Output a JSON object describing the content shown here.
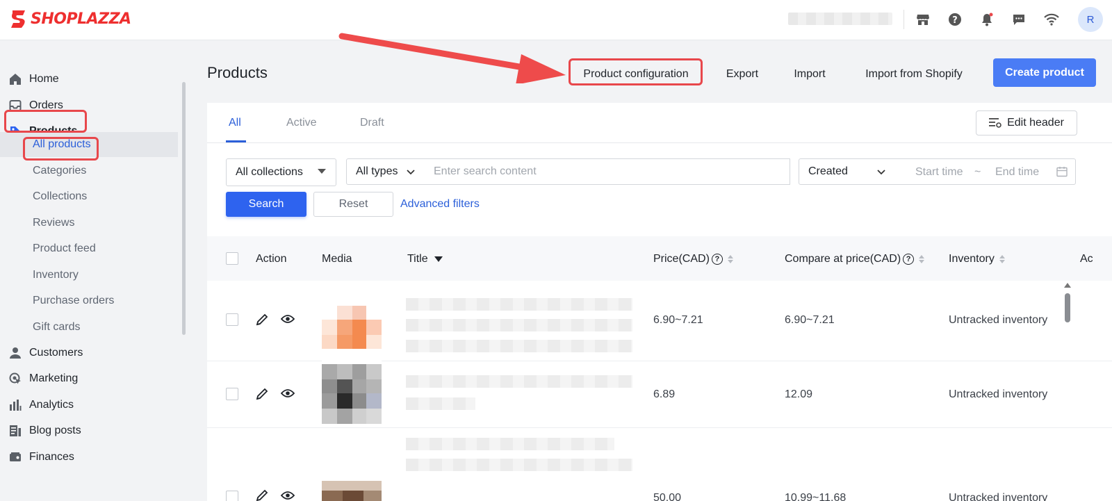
{
  "brand": {
    "name": "SHOPLAZZA",
    "color": "#ee2f2f"
  },
  "topbar": {
    "icons": [
      "store-icon",
      "help-icon",
      "bell-icon",
      "message-icon",
      "wifi-icon"
    ],
    "avatar_initial": "R"
  },
  "sidebar": {
    "items": [
      {
        "label": "Home",
        "icon": "home-icon"
      },
      {
        "label": "Orders",
        "icon": "inbox-icon"
      },
      {
        "label": "Products",
        "icon": "tag-icon"
      }
    ],
    "product_subitems": [
      "All products",
      "Categories",
      "Collections",
      "Reviews",
      "Product feed",
      "Inventory",
      "Purchase orders",
      "Gift cards"
    ],
    "more_items": [
      {
        "label": "Customers",
        "icon": "person-icon"
      },
      {
        "label": "Marketing",
        "icon": "marketing-icon"
      },
      {
        "label": "Analytics",
        "icon": "analytics-icon"
      },
      {
        "label": "Blog posts",
        "icon": "blog-icon"
      },
      {
        "label": "Finances",
        "icon": "finances-icon"
      }
    ],
    "active_subitem": "All products"
  },
  "header": {
    "title": "Products",
    "actions": [
      "Product configuration",
      "Export",
      "Import",
      "Import from Shopify"
    ],
    "create_label": "Create product"
  },
  "tabs": [
    "All",
    "Active",
    "Draft"
  ],
  "edit_header_label": "Edit header",
  "filters": {
    "collections": "All collections",
    "types": "All types",
    "search_placeholder": "Enter search content",
    "date_field": "Created",
    "start_placeholder": "Start time",
    "range_sep": "~",
    "end_placeholder": "End time",
    "search_label": "Search",
    "reset_label": "Reset",
    "advanced_label": "Advanced filters"
  },
  "table": {
    "columns": [
      "Action",
      "Media",
      "Title",
      "Price(CAD)",
      "Compare at price(CAD)",
      "Inventory",
      "Ac"
    ],
    "rows": [
      {
        "price": "6.90~7.21",
        "compare": "6.90~7.21",
        "inventory": "Untracked inventory"
      },
      {
        "price": "6.89",
        "compare": "12.09",
        "inventory": "Untracked inventory"
      },
      {
        "price": "50.00",
        "compare": "10.99~11.68",
        "inventory": "Untracked inventory"
      }
    ]
  },
  "colors": {
    "accent": "#4a7cf5",
    "primary_button": "#2e63ef",
    "highlight": "#e8474b",
    "link": "#2b5fd9"
  }
}
